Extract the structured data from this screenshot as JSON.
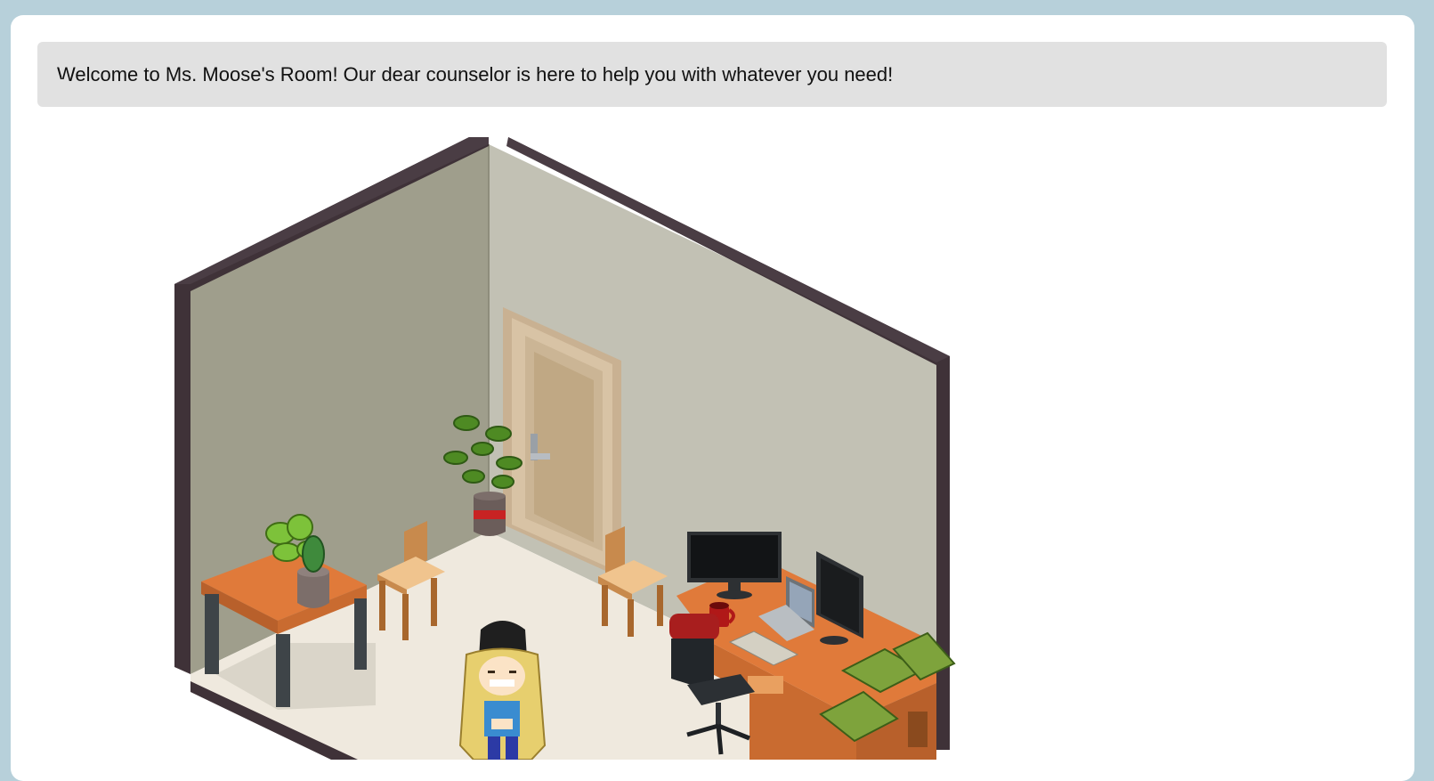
{
  "room": {
    "welcome_message": "Welcome to Ms. Moose's Room! Our dear counselor is here to help you with whatever you need!",
    "furniture": [
      "side-table",
      "potted-plant",
      "cactus-pot",
      "wooden-chair",
      "tall-potted-plant",
      "door",
      "wooden-chair",
      "office-chair",
      "desk",
      "monitor",
      "laptop",
      "keyboard",
      "coffee-mug",
      "books"
    ]
  },
  "colors": {
    "page_bg": "#b7d0da",
    "panel_bg": "#ffffff",
    "bubble_bg": "#e1e1e1",
    "wall_left": "#9f9e8c",
    "wall_right": "#c2c1b4",
    "wall_trim": "#4a3d44",
    "floor": "#efe9de",
    "wood": "#e07a3a",
    "door": "#d8c3a5"
  }
}
